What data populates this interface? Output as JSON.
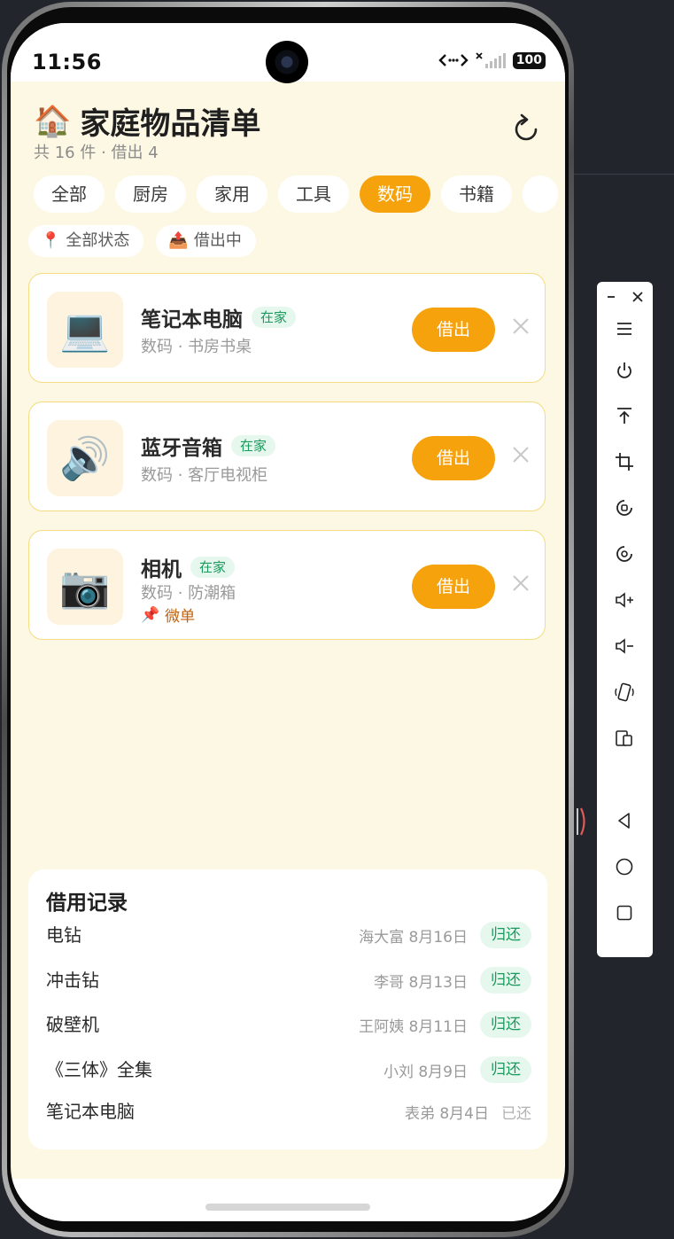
{
  "status": {
    "time": "11:56",
    "battery": "100"
  },
  "header": {
    "title": "家庭物品清单",
    "subtitle": "共 16 件 · 借出 4"
  },
  "tabs": [
    "全部",
    "厨房",
    "家用",
    "工具",
    "数码",
    "书籍"
  ],
  "active_tab": "数码",
  "filters": [
    {
      "label": "全部状态",
      "icon": "pin-icon"
    },
    {
      "label": "借出中",
      "icon": "outbox-icon"
    }
  ],
  "items": [
    {
      "name": "笔记本电脑",
      "status": "在家",
      "meta": "数码 · 书房书桌",
      "action": "借出",
      "icon": "laptop-icon"
    },
    {
      "name": "蓝牙音箱",
      "status": "在家",
      "meta": "数码 · 客厅电视柜",
      "action": "借出",
      "icon": "speaker-icon"
    },
    {
      "name": "相机",
      "status": "在家",
      "meta": "数码 · 防潮箱",
      "note": "微单",
      "action": "借出",
      "icon": "camera-icon"
    }
  ],
  "records": {
    "title": "借用记录",
    "rows": [
      {
        "name": "电钻",
        "who": "海大富 8月16日",
        "action": "归还"
      },
      {
        "name": "冲击钻",
        "who": "李哥 8月13日",
        "action": "归还"
      },
      {
        "name": "破壁机",
        "who": "王阿姨 8月11日",
        "action": "归还"
      },
      {
        "name": "《三体》全集",
        "who": "小刘 8月9日",
        "action": "归还"
      },
      {
        "name": "笔记本电脑",
        "who": "表弟 8月4日",
        "status": "已还"
      }
    ]
  },
  "colors": {
    "accent": "#f5a20c",
    "background": "#fdf8e3",
    "success": "#1a9a5c"
  }
}
